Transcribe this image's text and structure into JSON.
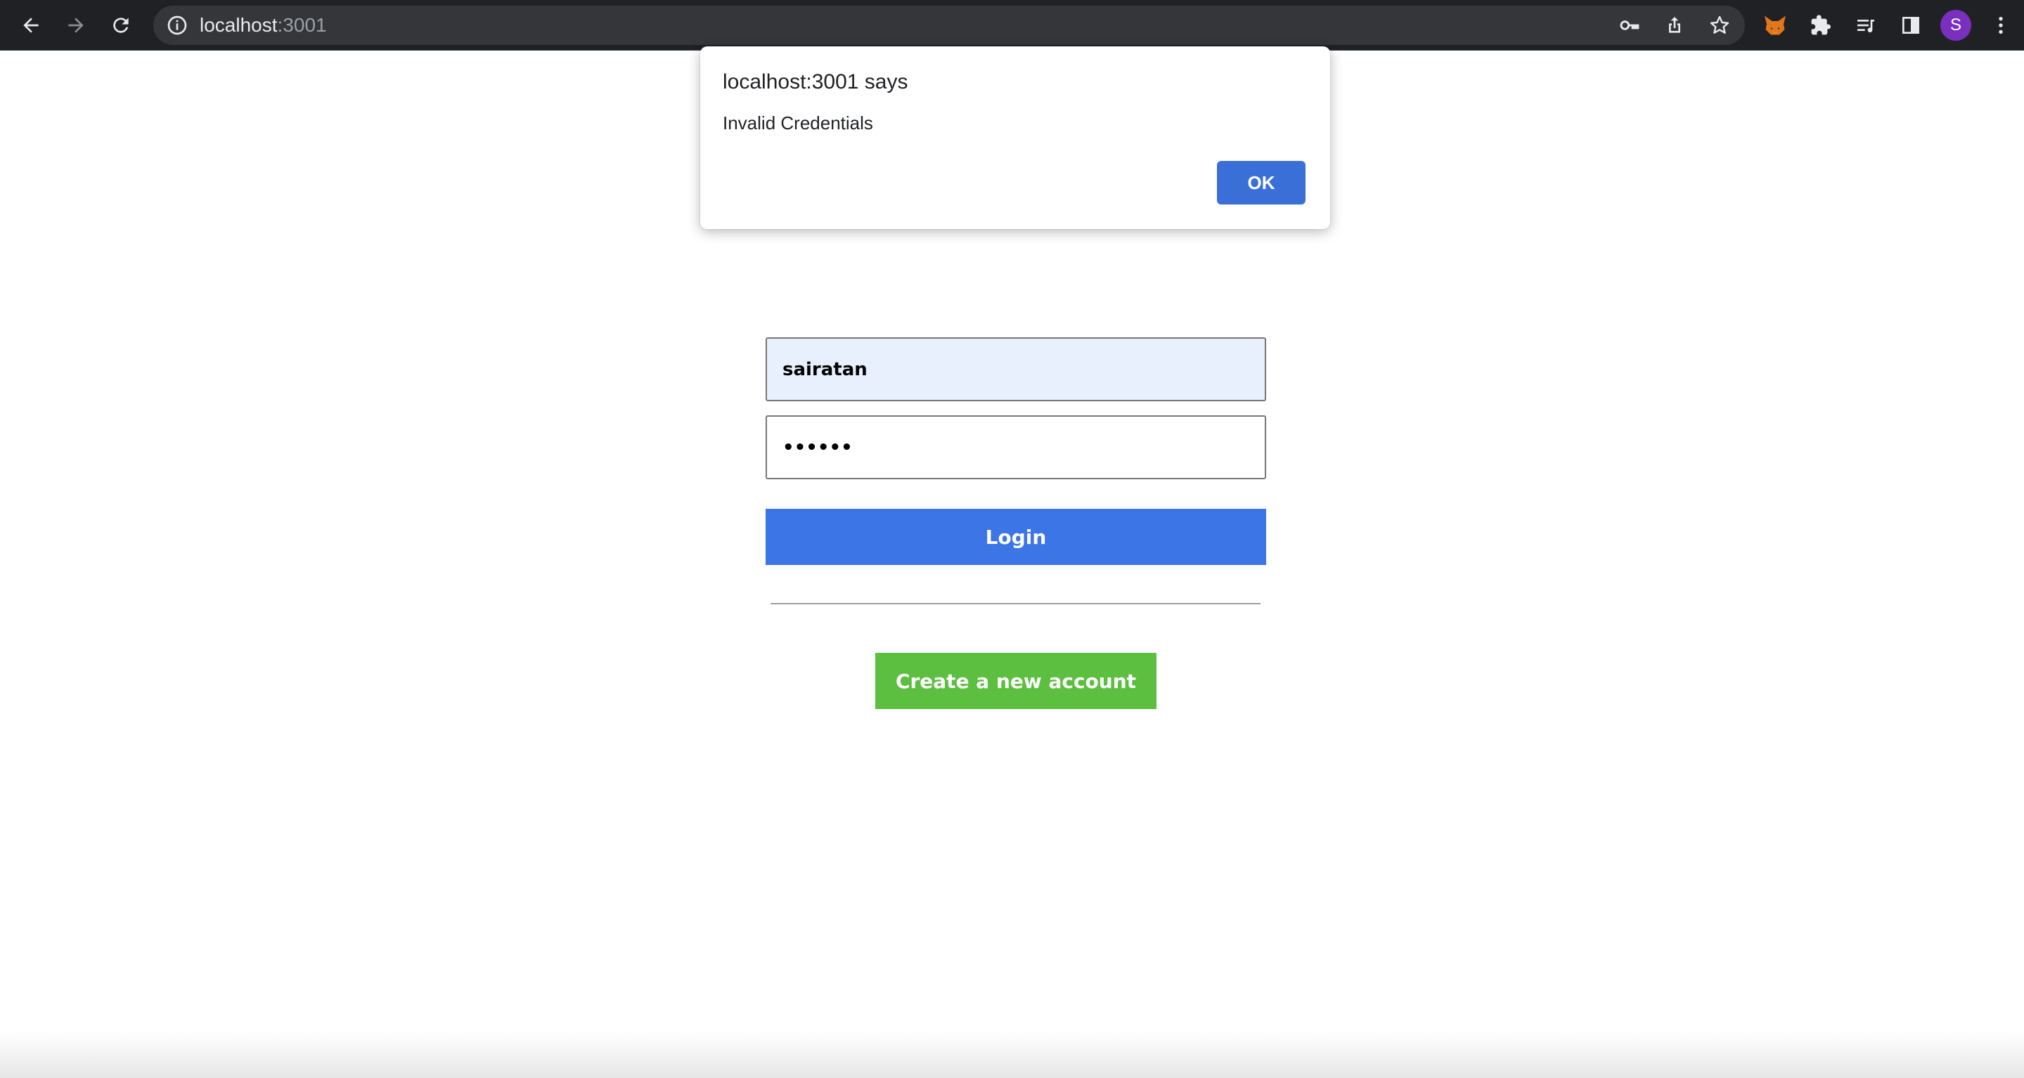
{
  "browser": {
    "url_host": "localhost",
    "url_port": ":3001",
    "profile_initial": "S",
    "accent": "#7b2fbf"
  },
  "dialog": {
    "title": "localhost:3001 says",
    "message": "Invalid Credentials",
    "ok_label": "OK",
    "ok_color": "#3b6fd8"
  },
  "form": {
    "username_value": "sairatan",
    "password_value": "••••••",
    "login_label": "Login",
    "login_color": "#3c75e6",
    "create_label": "Create a new account",
    "create_color": "#5cbf40"
  },
  "icons": [
    "back-icon",
    "forward-icon",
    "reload-icon",
    "info-icon",
    "key-icon",
    "share-icon",
    "star-icon",
    "fox-extension-icon",
    "puzzle-icon",
    "reading-list-icon",
    "side-panel-icon",
    "kebab-menu-icon"
  ]
}
